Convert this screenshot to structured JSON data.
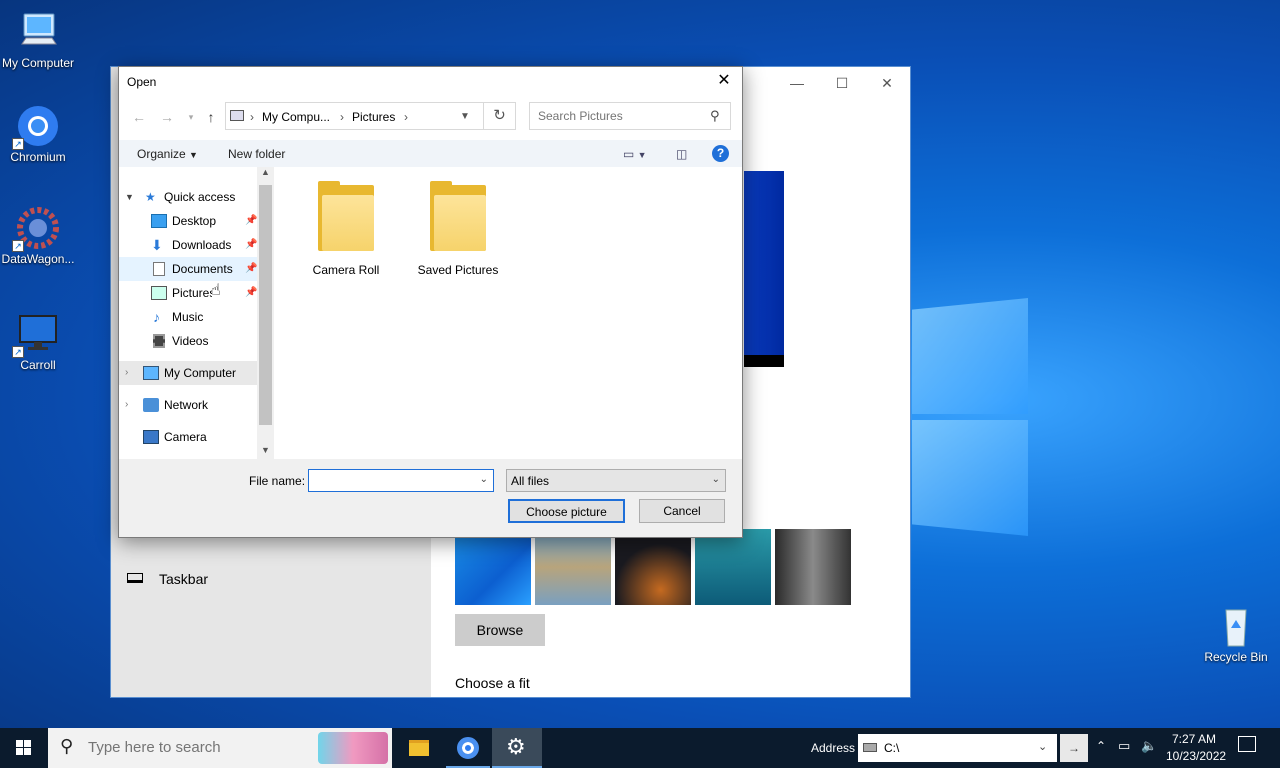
{
  "desktop": {
    "icons": [
      {
        "label": "My Computer"
      },
      {
        "label": "Chromium"
      },
      {
        "label": "DataWagon..."
      },
      {
        "label": "Carroll"
      },
      {
        "label": "Recycle Bin"
      }
    ]
  },
  "settings_window": {
    "taskbar_label": "Taskbar",
    "browse_label": "Browse",
    "choose_fit_label": "Choose a fit"
  },
  "dialog": {
    "title": "Open",
    "address": {
      "part1": "My Compu...",
      "part2": "Pictures"
    },
    "search_placeholder": "Search Pictures",
    "organize_label": "Organize",
    "new_folder_label": "New folder",
    "nav": {
      "quick_access": "Quick access",
      "desktop": "Desktop",
      "downloads": "Downloads",
      "documents": "Documents",
      "pictures": "Pictures",
      "music": "Music",
      "videos": "Videos",
      "my_computer": "My Computer",
      "network": "Network",
      "camera": "Camera"
    },
    "folders": [
      {
        "label": "Camera Roll"
      },
      {
        "label": "Saved Pictures"
      }
    ],
    "file_name_label": "File name:",
    "file_name_value": "",
    "file_type_value": "All files",
    "choose_button": "Choose picture",
    "cancel_button": "Cancel"
  },
  "taskbar": {
    "search_placeholder": "Type here to search",
    "address_label": "Address",
    "address_value": "C:\\",
    "time": "7:27 AM",
    "date": "10/23/2022"
  }
}
